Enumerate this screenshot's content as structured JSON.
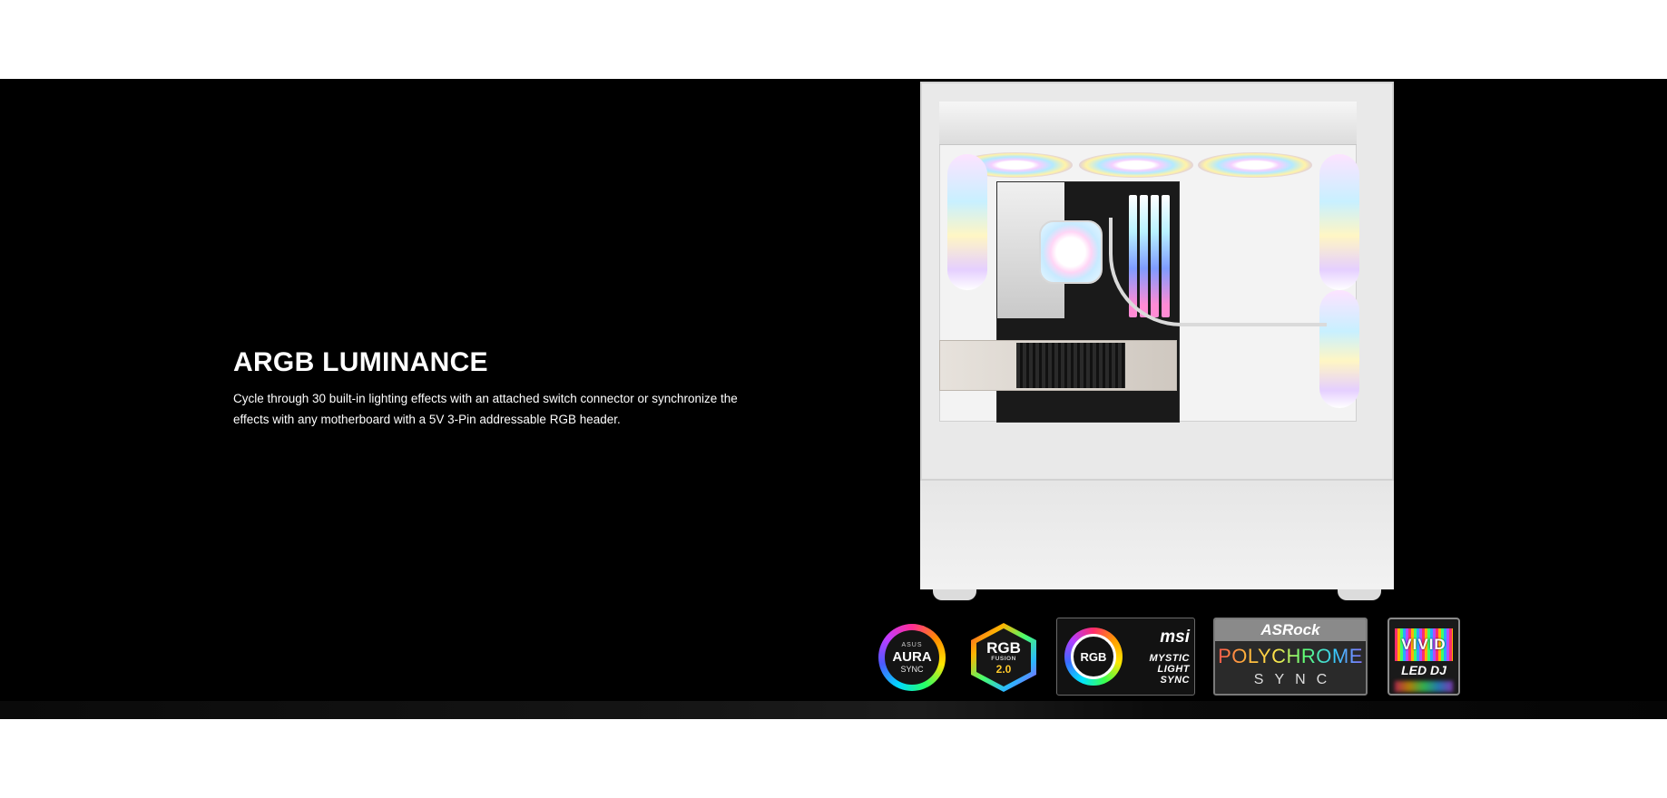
{
  "feature": {
    "title": "ARGB LUMINANCE",
    "description": "Cycle through 30 built-in lighting effects with an attached switch connector or synchronize the effects with any motherboard with a 5V 3-Pin addressable RGB header."
  },
  "sync_logos": {
    "asus": {
      "brand": "ASUS",
      "main": "AURA",
      "sub": "SYNC"
    },
    "gigabyte": {
      "main": "RGB",
      "word": "FUSION",
      "version": "2.0"
    },
    "msi": {
      "ring": "RGB",
      "brand": "msi",
      "line1": "MYSTIC",
      "line2": "LIGHT",
      "line3": "SYNC"
    },
    "asrock": {
      "brand": "ASRock",
      "main": "POLYCHROME",
      "sub": "SYNC"
    },
    "biostar": {
      "main": "VIVID",
      "sub": "LED DJ"
    }
  },
  "colors": {
    "band": "#000000",
    "page": "#ffffff",
    "text": "#ffffff"
  },
  "images": {
    "product": "white-pc-case-argb-illustration"
  }
}
